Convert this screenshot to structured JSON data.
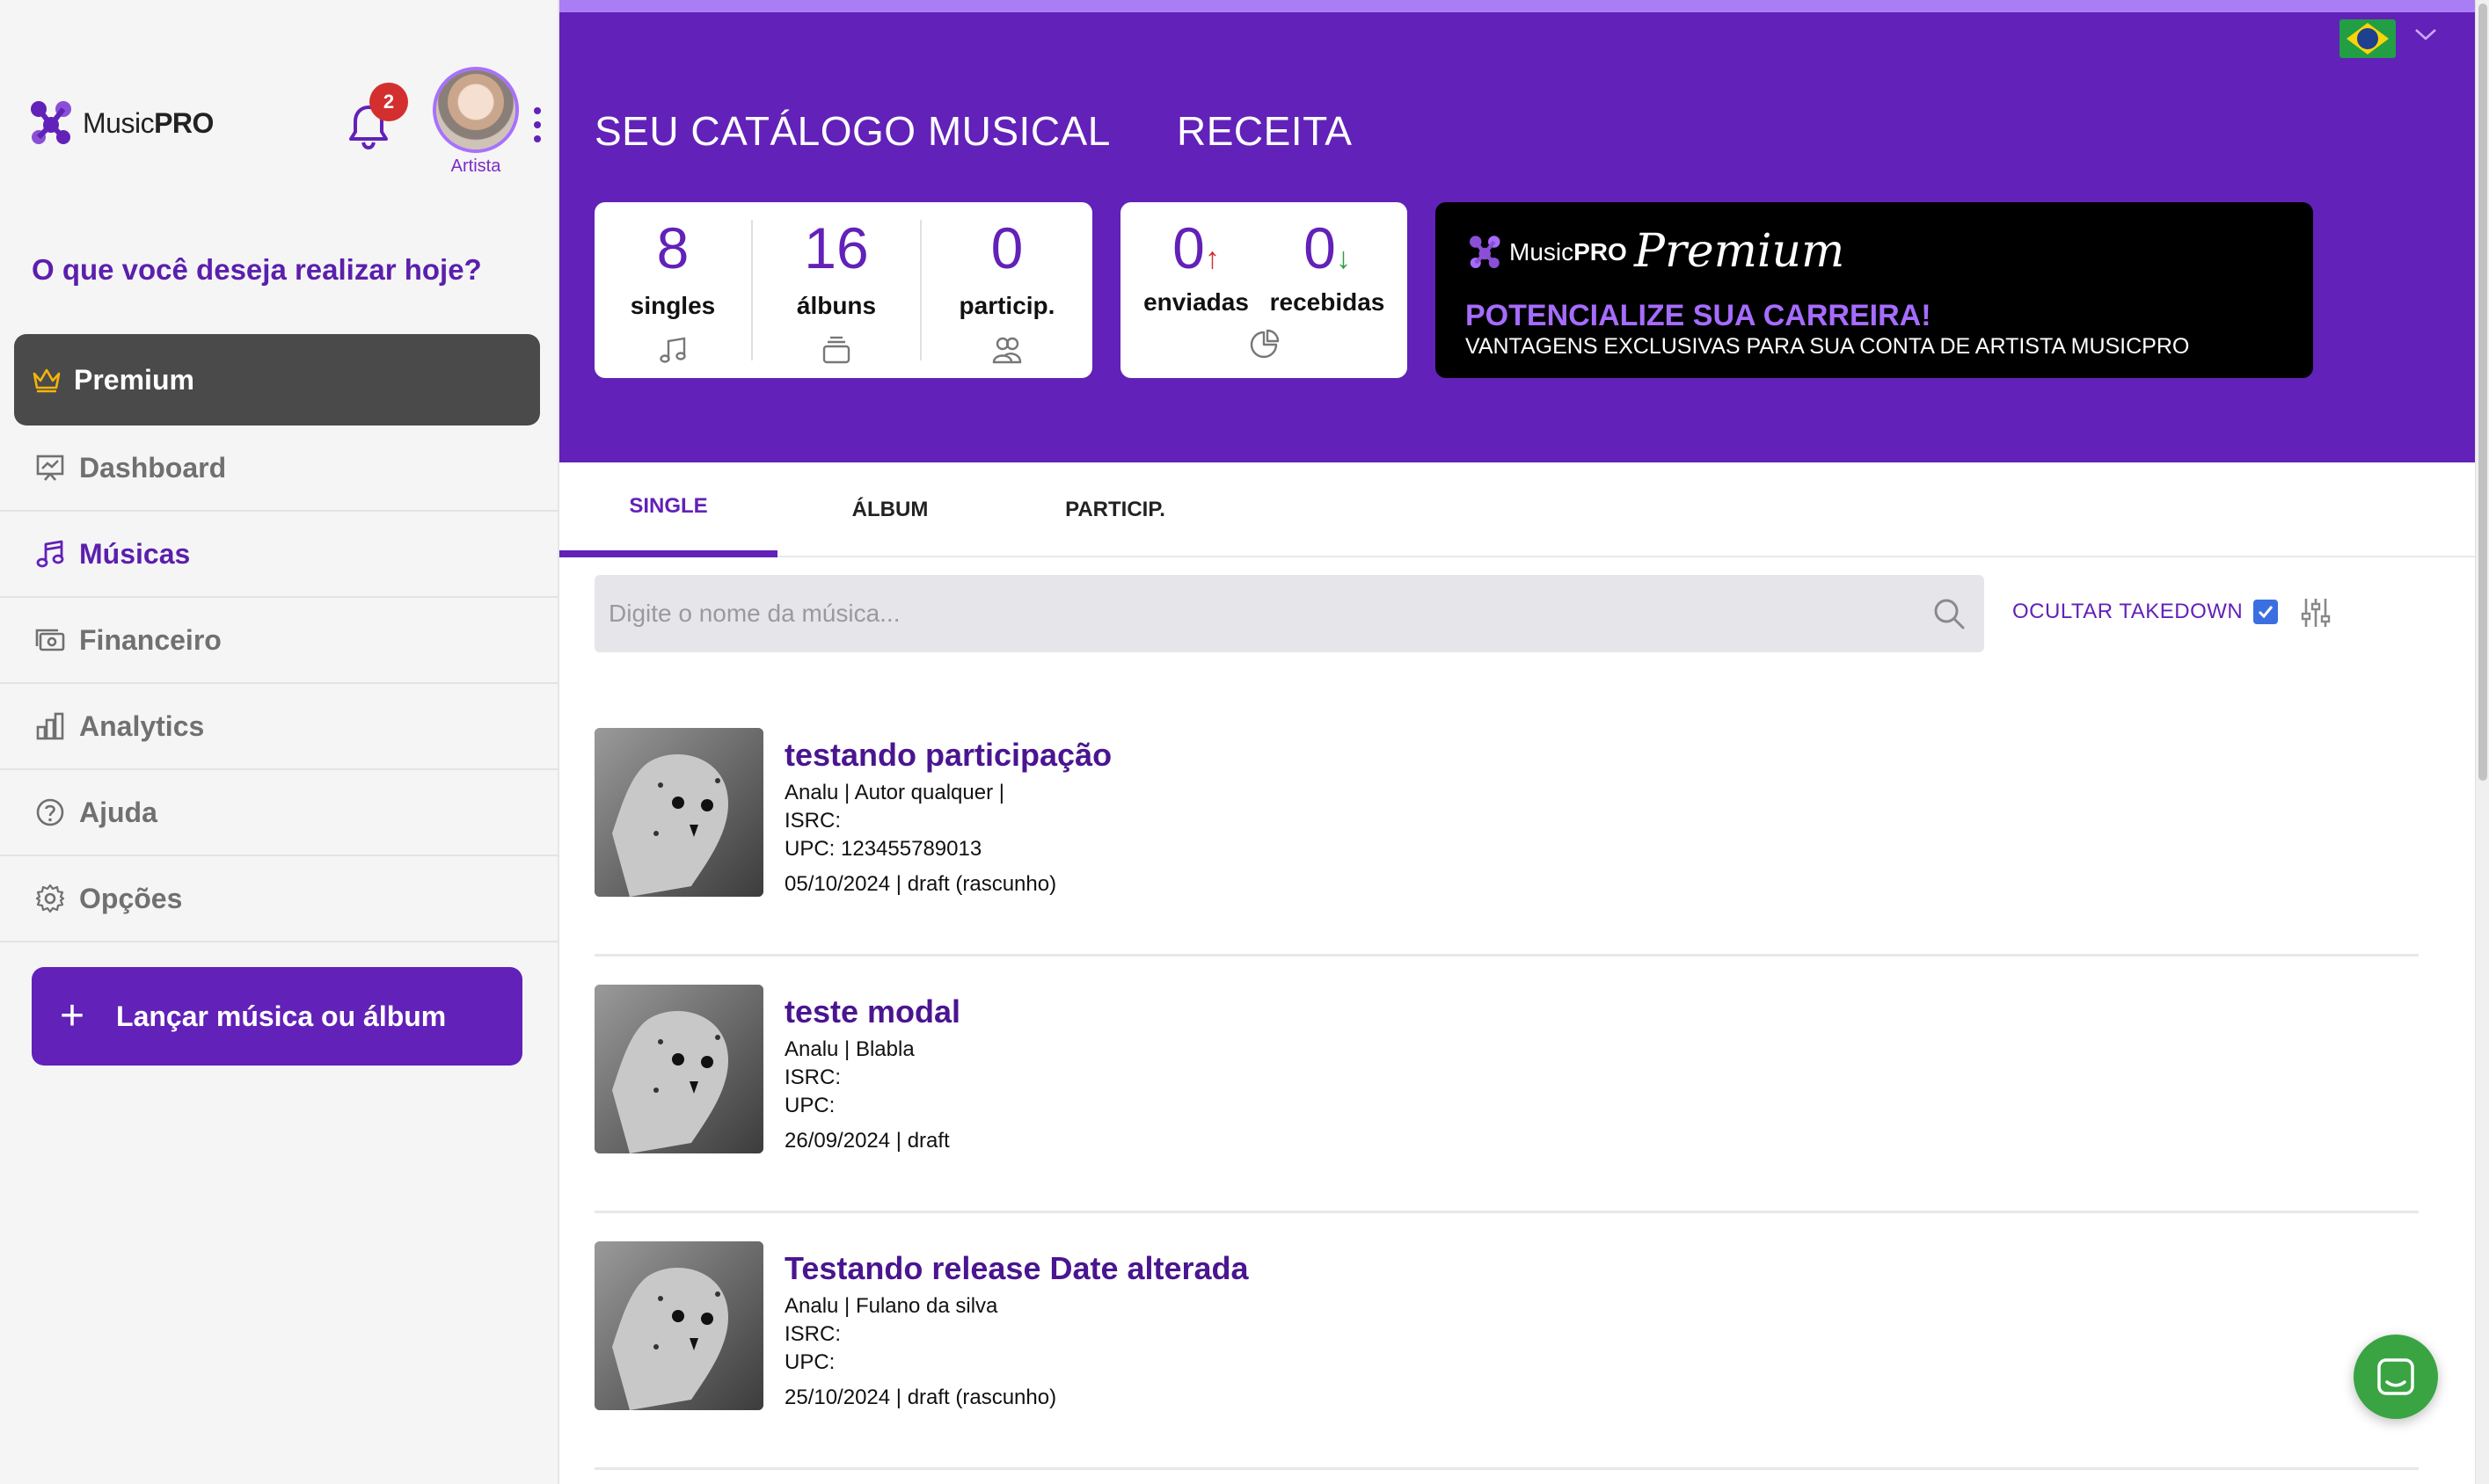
{
  "brand": {
    "name_regular": "Music",
    "name_bold": "PRO"
  },
  "notifications": {
    "count": "2"
  },
  "user": {
    "role": "Artista"
  },
  "sidebar": {
    "question": "O que você deseja realizar hoje?",
    "premium_label": "Premium",
    "items": [
      {
        "label": "Dashboard",
        "icon": "presentation-chart-icon"
      },
      {
        "label": "Músicas",
        "icon": "music-note-icon",
        "active": true
      },
      {
        "label": "Financeiro",
        "icon": "money-icon"
      },
      {
        "label": "Analytics",
        "icon": "bar-chart-icon"
      },
      {
        "label": "Ajuda",
        "icon": "help-circle-icon"
      },
      {
        "label": "Opções",
        "icon": "gear-icon"
      }
    ],
    "launch_button": "Lançar música ou álbum"
  },
  "header": {
    "catalog_title": "SEU CATÁLOGO MUSICAL",
    "revenue_title": "RECEITA",
    "language": "pt-BR",
    "stats": [
      {
        "value": "8",
        "label": "singles"
      },
      {
        "value": "16",
        "label": "álbuns"
      },
      {
        "value": "0",
        "label": "particip."
      }
    ],
    "revenue": [
      {
        "value": "0",
        "label": "enviadas"
      },
      {
        "value": "0",
        "label": "recebidas"
      }
    ],
    "promo": {
      "logo_regular": "Music",
      "logo_bold": "PRO",
      "script": "Premium",
      "headline": "POTENCIALIZE SUA CARREIRA!",
      "subline": "VANTAGENS EXCLUSIVAS PARA SUA CONTA DE ARTISTA MUSICPRO"
    }
  },
  "tabs": [
    {
      "label": "SINGLE",
      "active": true
    },
    {
      "label": "ÁLBUM",
      "active": false
    },
    {
      "label": "PARTICIP.",
      "active": false
    }
  ],
  "search": {
    "placeholder": "Digite o nome da música...",
    "value": ""
  },
  "takedown": {
    "label": "OCULTAR TAKEDOWN",
    "checked": true
  },
  "songs": [
    {
      "title": "testando participação",
      "artists": "Analu | Autor qualquer |",
      "isrc": "ISRC:",
      "upc": "UPC: 123455789013",
      "date_status": "05/10/2024 | draft (rascunho)"
    },
    {
      "title": "teste modal",
      "artists": "Analu | Blabla",
      "isrc": "ISRC:",
      "upc": "UPC:",
      "date_status": "26/09/2024 | draft"
    },
    {
      "title": "Testando release Date alterada",
      "artists": "Analu | Fulano da silva",
      "isrc": "ISRC:",
      "upc": "UPC:",
      "date_status": "25/10/2024 | draft (rascunho)"
    }
  ],
  "colors": {
    "brand_purple": "#6221b8",
    "header_top_line": "#a97ef5",
    "sidebar_bg": "#f5f5f5",
    "premium_bg": "#4a4a4a",
    "chat_green": "#3aa443",
    "badge_red": "#d32f2f"
  }
}
